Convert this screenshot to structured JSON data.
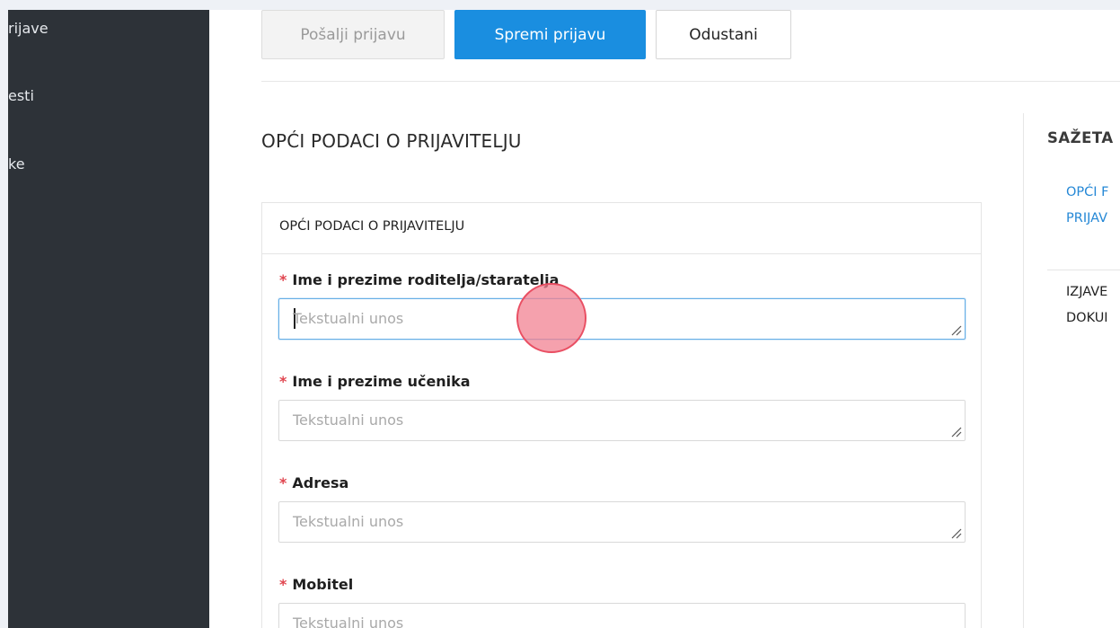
{
  "sidebar": {
    "items": [
      {
        "label": "rijave"
      },
      {
        "label": "esti"
      },
      {
        "label": "ke"
      }
    ]
  },
  "toolbar": {
    "send_label": "Pošalji prijavu",
    "save_label": "Spremi prijavu",
    "cancel_label": "Odustani"
  },
  "main": {
    "section_title": "OPĆI PODACI O PRIJAVITELJU",
    "panel_title": "OPĆI PODACI O PRIJAVITELJU",
    "required_marker": "*",
    "fields": [
      {
        "label": "Ime i prezime roditelja/staratelja",
        "placeholder": "Tekstualni unos",
        "focused": true
      },
      {
        "label": "Ime i prezime učenika",
        "placeholder": "Tekstualni unos"
      },
      {
        "label": "Adresa",
        "placeholder": "Tekstualni unos"
      },
      {
        "label": "Mobitel",
        "placeholder": "Tekstualni unos"
      }
    ]
  },
  "summary": {
    "title": "SAŽETA",
    "nav": [
      {
        "line1": "OPĆI F",
        "line2": "PRIJAV",
        "active": true
      },
      {
        "line1": "IZJAVE",
        "line2": "DOKUI",
        "active": false
      }
    ]
  },
  "colors": {
    "sidebar_bg": "#2d3238",
    "primary": "#1a8ee0",
    "required": "#e0444e",
    "link": "#2588d6",
    "click_marker": "#e94f63"
  }
}
